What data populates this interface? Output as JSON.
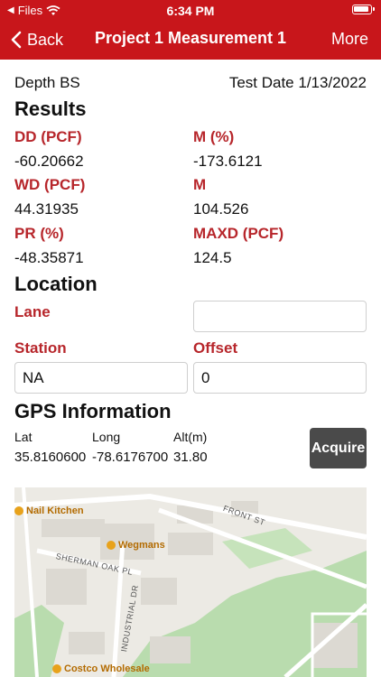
{
  "status_bar": {
    "back_app": "Files",
    "time": "6:34 PM"
  },
  "nav": {
    "back_label": "Back",
    "title": "Project 1 Measurement 1",
    "more_label": "More"
  },
  "info": {
    "depth": "Depth BS",
    "test_date": "Test Date 1/13/2022"
  },
  "results": {
    "heading": "Results",
    "items": [
      {
        "label": "DD (PCF)",
        "value": "-60.20662"
      },
      {
        "label": "M (%)",
        "value": "-173.6121"
      },
      {
        "label": "WD (PCF)",
        "value": "44.31935"
      },
      {
        "label": "M",
        "value": "104.526"
      },
      {
        "label": "PR (%)",
        "value": "-48.35871"
      },
      {
        "label": "MAXD (PCF)",
        "value": "124.5"
      }
    ]
  },
  "location": {
    "heading": "Location",
    "lane_label": "Lane",
    "lane_value": "",
    "station_label": "Station",
    "station_value": "NA",
    "offset_label": "Offset",
    "offset_value": "0"
  },
  "gps": {
    "heading": "GPS Information",
    "lat_label": "Lat",
    "long_label": "Long",
    "alt_label": "Alt(m)",
    "lat": "35.8160600",
    "long": "-78.6176700",
    "alt": "31.80",
    "acquire_label": "Acquire"
  },
  "map": {
    "poi_nail": "Nail Kitchen",
    "poi_wegmans": "Wegmans",
    "poi_costco": "Costco Wholesale",
    "street_front": "FRONT ST",
    "street_sherman": "SHERMAN OAK PL",
    "street_industrial": "INDUSTRIAL DR",
    "colors": {
      "land": "#eceae4",
      "park": "#b9dcae",
      "road": "#ffffff",
      "building": "#dcd9d2",
      "poi": "#e8a21b"
    }
  },
  "theme": {
    "primary": "#c8161b",
    "label": "#b7262b",
    "button": "#4a4a4a"
  }
}
